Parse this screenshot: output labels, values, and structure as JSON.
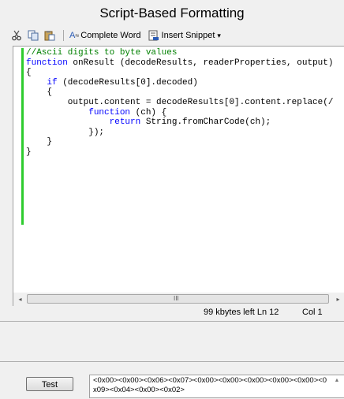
{
  "window": {
    "title": "Script-Based Formatting"
  },
  "toolbar": {
    "cut_icon": "scissors-icon",
    "copy_icon": "copy-icon",
    "paste_icon": "paste-icon",
    "complete_word_label": "Complete Word",
    "insert_snippet_label": "Insert Snippet",
    "insert_snippet_arrow": "▾"
  },
  "editor": {
    "lines": [
      {
        "segments": [
          {
            "t": "//Ascii digits to byte values",
            "c": "cm"
          }
        ]
      },
      {
        "segments": [
          {
            "t": "function",
            "c": "kw"
          },
          {
            "t": " onResult (decodeResults, readerProperties, output)"
          }
        ]
      },
      {
        "segments": [
          {
            "t": "{"
          }
        ]
      },
      {
        "segments": [
          {
            "t": "    "
          },
          {
            "t": "if",
            "c": "kw"
          },
          {
            "t": " (decodeResults[0].decoded)"
          }
        ]
      },
      {
        "segments": [
          {
            "t": "    {"
          }
        ]
      },
      {
        "segments": [
          {
            "t": "        output.content = decodeResults[0].content.replace(/"
          }
        ]
      },
      {
        "segments": [
          {
            "t": "            "
          },
          {
            "t": "function",
            "c": "kw"
          },
          {
            "t": " (ch) {"
          }
        ]
      },
      {
        "segments": [
          {
            "t": "                "
          },
          {
            "t": "return",
            "c": "kw"
          },
          {
            "t": " String.fromCharCode(ch);"
          }
        ]
      },
      {
        "segments": [
          {
            "t": "            });"
          }
        ]
      },
      {
        "segments": [
          {
            "t": "    }"
          }
        ]
      },
      {
        "segments": [
          {
            "t": "}"
          }
        ]
      }
    ]
  },
  "scrollbar": {
    "left_arrow": "◂",
    "right_arrow": "▸",
    "grip": "III"
  },
  "status": {
    "kbytes_left": "99 kbytes left",
    "line": "Ln 12",
    "col": "Col 1"
  },
  "test": {
    "button_label": "Test",
    "result_text": "<0x00><0x00><0x06><0x07><0x00><0x00><0x00><0x00><0x00><0x09><0x04><0x00><0x02>",
    "result_scroll_up": "▲"
  },
  "colors": {
    "accent_green": "#2ecc2e",
    "keyword_blue": "#0000ff",
    "comment_green": "#008000"
  }
}
